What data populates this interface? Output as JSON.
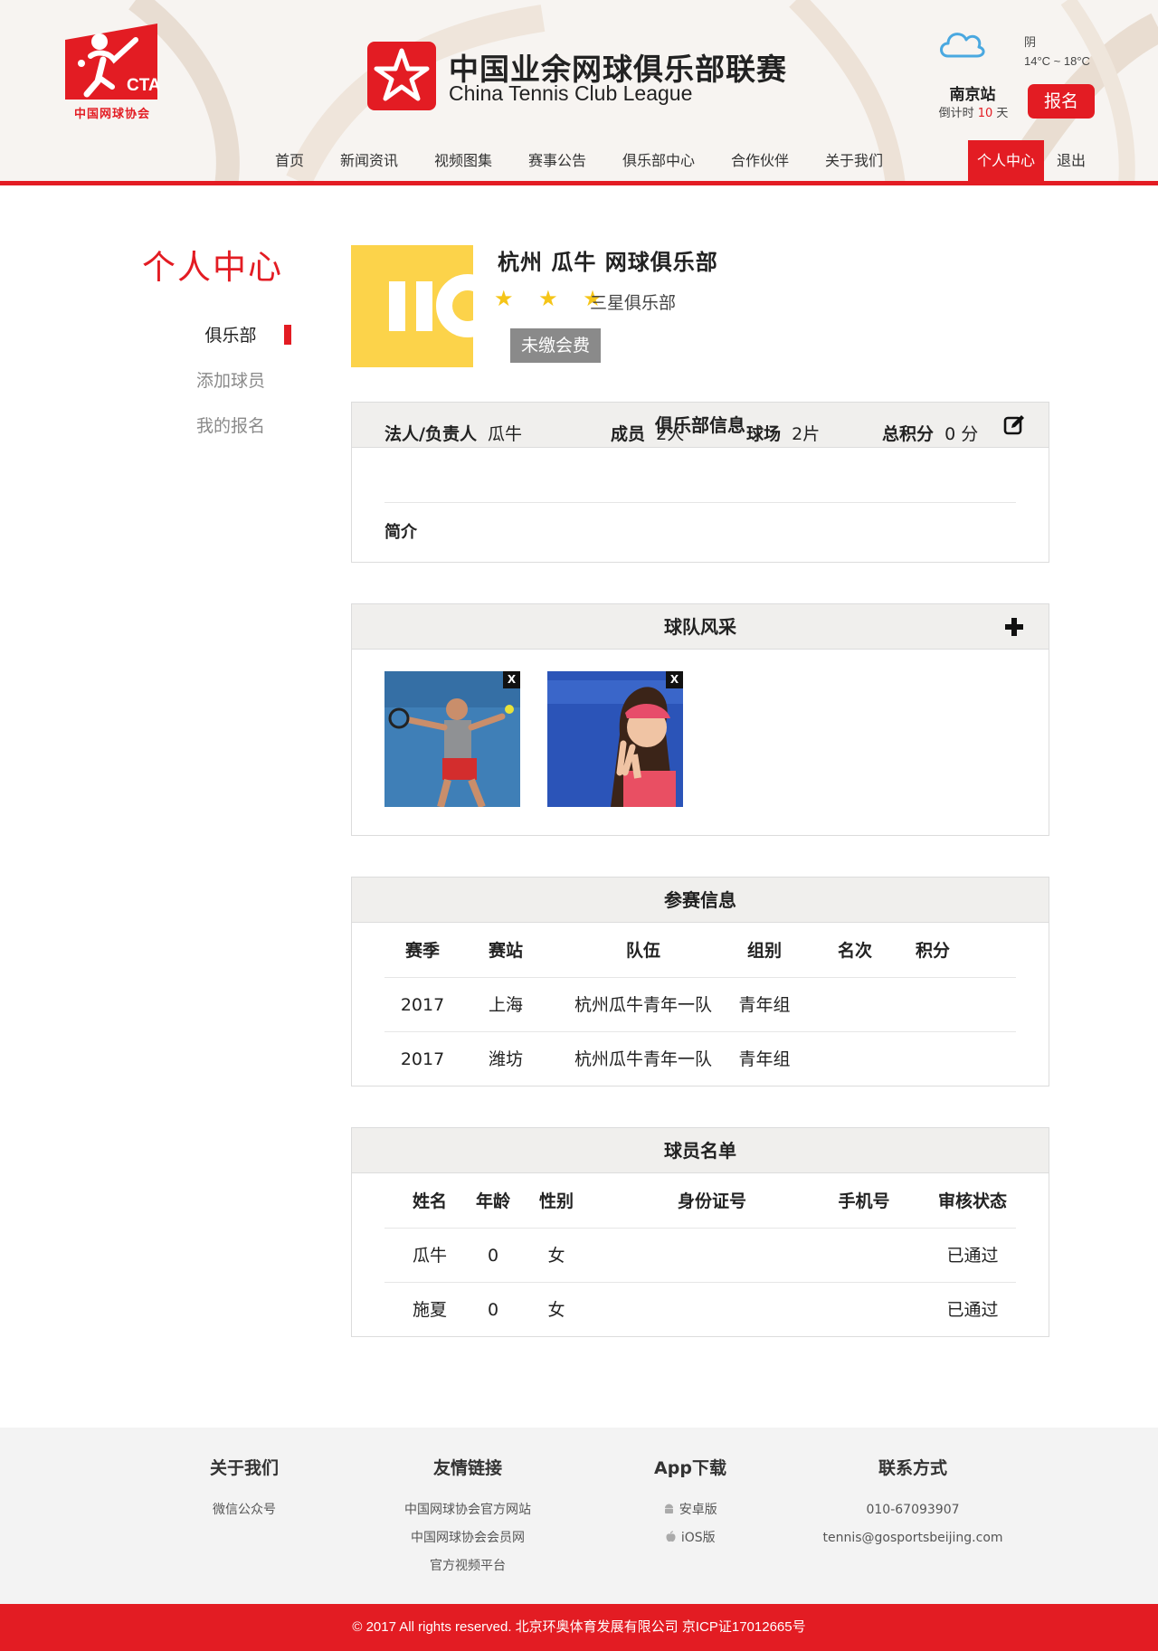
{
  "header": {
    "cta_logo_text": "CTA",
    "cta_org": "中国网球协会",
    "brand_cn": "中国业余网球俱乐部联赛",
    "brand_en": "China Tennis Club League",
    "weather_condition": "阴",
    "weather_temp": "14°C ~ 18°C",
    "station": "南京站",
    "countdown_prefix": "倒计时",
    "countdown_days": "10",
    "countdown_suffix": "天",
    "signup_label": "报名"
  },
  "nav": {
    "home": "首页",
    "news": "新闻资讯",
    "media": "视频图集",
    "notices": "赛事公告",
    "clubs": "俱乐部中心",
    "partners": "合作伙伴",
    "about": "关于我们",
    "personal": "个人中心",
    "logout": "退出"
  },
  "sidebar": {
    "title": "个人中心",
    "items": [
      "俱乐部",
      "添加球员",
      "我的报名"
    ]
  },
  "club": {
    "name": "杭州 瓜牛 网球俱乐部",
    "stars": "★ ★ ★",
    "star_rating": 3,
    "level": "三星俱乐部",
    "fee_status": "未缴会费"
  },
  "club_info": {
    "title": "俱乐部信息",
    "legal_label": "法人/负责人",
    "legal_value": "瓜牛",
    "members_label": "成员",
    "members_value": "2人",
    "courts_label": "球场",
    "courts_value": "2片",
    "points_label": "总积分",
    "points_value": "0 分",
    "intro_label": "简介"
  },
  "team_gallery": {
    "title": "球队风采",
    "close_label": "X"
  },
  "competition": {
    "title": "参赛信息",
    "headers": [
      "赛季",
      "赛站",
      "队伍",
      "组别",
      "名次",
      "积分"
    ],
    "rows": [
      [
        "2017",
        "上海",
        "杭州瓜牛青年一队",
        "青年组",
        "",
        ""
      ],
      [
        "2017",
        "潍坊",
        "杭州瓜牛青年一队",
        "青年组",
        "",
        ""
      ]
    ]
  },
  "roster": {
    "title": "球员名单",
    "headers": [
      "姓名",
      "年龄",
      "性别",
      "身份证号",
      "手机号",
      "审核状态"
    ],
    "rows": [
      [
        "瓜牛",
        "0",
        "女",
        "",
        "",
        "已通过"
      ],
      [
        "施夏",
        "0",
        "女",
        "",
        "",
        "已通过"
      ]
    ]
  },
  "footer": {
    "about_title": "关于我们",
    "about_links": [
      "微信公众号"
    ],
    "links_title": "友情链接",
    "links": [
      "中国网球协会官方网站",
      "中国网球协会会员网",
      "官方视频平台"
    ],
    "app_title": "App下载",
    "app_android": "安卓版",
    "app_ios": "iOS版",
    "contact_title": "联系方式",
    "phone": "010-67093907",
    "email": "tennis@gosportsbeijing.com",
    "copyright": "© 2017 All rights reserved. 北京环奥体育发展有限公司 京ICP证17012665号"
  },
  "colors": {
    "brand_red": "#e31c23",
    "star_yellow": "#f5c518",
    "badge_gray": "#8a8a8a",
    "panel_head": "#f0efed"
  }
}
